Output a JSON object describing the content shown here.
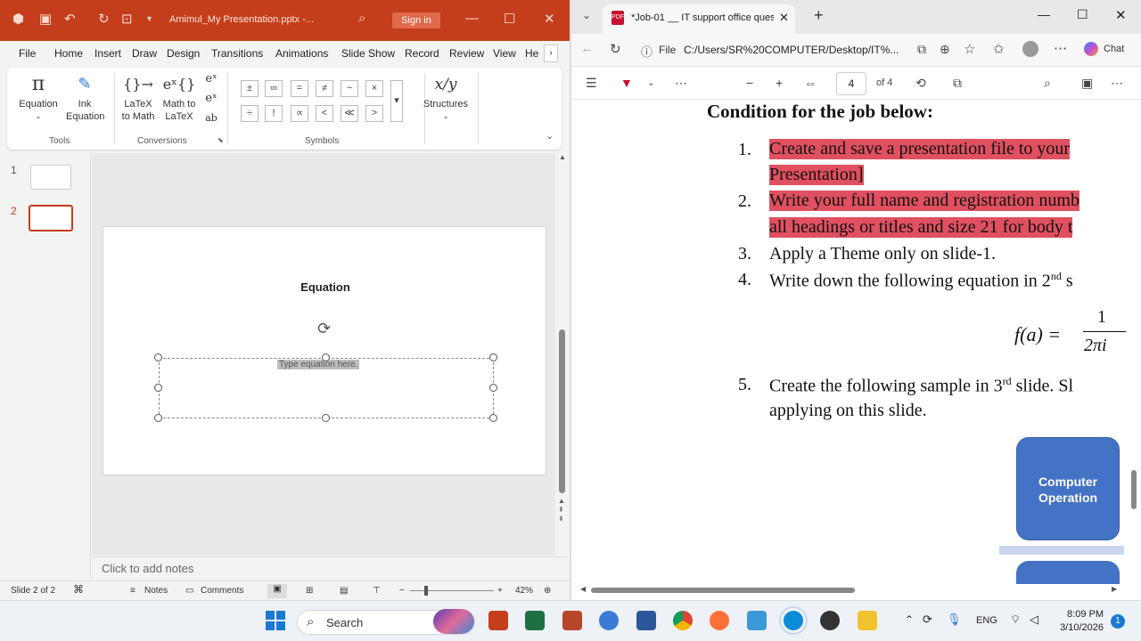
{
  "ppt": {
    "filename": "Amimul_My Presentation.pptx  -...",
    "signin": "Sign in",
    "tabs": [
      "File",
      "Home",
      "Insert",
      "Draw",
      "Design",
      "Transitions",
      "Animations",
      "Slide Show",
      "Record",
      "Review",
      "View",
      "He"
    ],
    "ribbon": {
      "equation": "Equation",
      "ink_equation_1": "Ink",
      "ink_equation_2": "Equation",
      "latex_to_math_1": "LaTeX",
      "latex_to_math_2": "to Math",
      "math_to_latex_1": "Math to",
      "math_to_latex_2": "LaTeX",
      "structures": "Structures",
      "groups": {
        "tools": "Tools",
        "conversions": "Conversions",
        "symbols": "Symbols"
      },
      "symbols_row1": [
        "±",
        "∞",
        "=",
        "≠",
        "~",
        "×"
      ],
      "symbols_row2": [
        "÷",
        "!",
        "∝",
        "<",
        "≪",
        ">"
      ],
      "ab_label": "ab"
    },
    "slide_numbers": [
      "1",
      "2"
    ],
    "slide_title": "Equation",
    "equation_placeholder": "Type equation here.",
    "notes_placeholder": "Click to add notes",
    "status": {
      "slide_info": "Slide 2 of 2",
      "notes": "Notes",
      "comments": "Comments",
      "zoom": "42%"
    }
  },
  "edge": {
    "tab_title": "*Job-01 __ IT support office quest",
    "url_prefix": "File",
    "url": "C:/Users/SR%20COMPUTER/Desktop/IT%...",
    "chat": "Chat",
    "page_current": "4",
    "page_total": "of 4"
  },
  "pdf": {
    "heading": "Condition for the job below:",
    "items": [
      {
        "num": "1.",
        "line1": "Create and save a presentation file to your",
        "line2": "Presentation]"
      },
      {
        "num": "2.",
        "line1": "Write your full name and registration numb",
        "line2": "all headings or titles and size 21 for body t"
      },
      {
        "num": "3.",
        "line1": "Apply a Theme only on slide-1."
      },
      {
        "num": "4.",
        "line1_pre": "Write down the following equation in 2",
        "sup": "nd",
        "line1_post": " s"
      },
      {
        "num": "5.",
        "line1_pre": "Create the following sample in 3",
        "sup": "rd",
        "line1_post": " slide. Sl",
        "line2": "applying on this slide."
      }
    ],
    "equation": {
      "lhs": "f(a) =",
      "numerator": "1",
      "denominator": "2πi"
    },
    "diagram_box": "Computer Operation"
  },
  "taskbar": {
    "search": "Search",
    "lang": "ENG",
    "time": "8:09 PM",
    "date": "3/10/2026",
    "notif_count": "1"
  },
  "colors": {
    "ppt_red": "#c43e1c",
    "pdf_highlight": "#e05060",
    "diagram_blue": "#4472c4"
  }
}
